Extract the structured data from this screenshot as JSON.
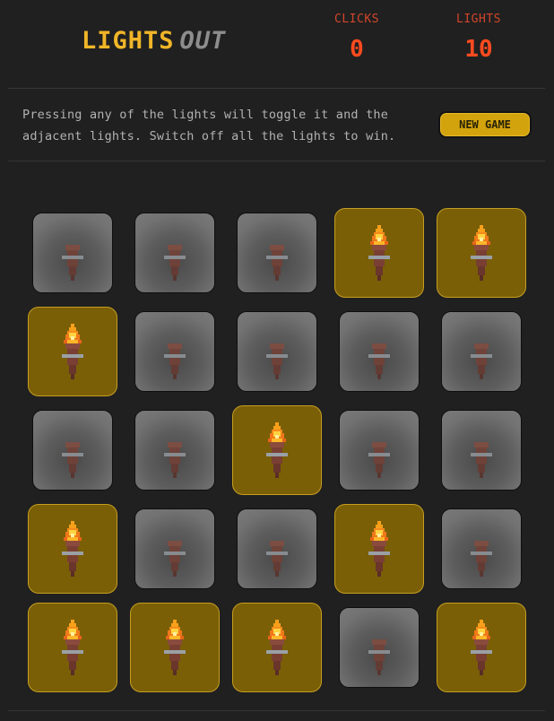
{
  "header": {
    "title_word1": "LIGHTS",
    "title_word2": "OUT",
    "clicks_label": "CLICKS",
    "clicks_value": "0",
    "lights_label": "LIGHTS",
    "lights_value": "10"
  },
  "instructions": {
    "line1": "Pressing any of the lights will toggle it and the",
    "line2": "adjacent lights. Switch off all the lights to win."
  },
  "controls": {
    "new_game_label": "NEW GAME"
  },
  "board": {
    "rows": 5,
    "cols": 5,
    "cells": [
      [
        false,
        false,
        false,
        true,
        true
      ],
      [
        true,
        false,
        false,
        false,
        false
      ],
      [
        false,
        false,
        true,
        false,
        false
      ],
      [
        true,
        false,
        false,
        true,
        false
      ],
      [
        true,
        true,
        true,
        false,
        true
      ]
    ],
    "icon": "torch-icon"
  },
  "colors": {
    "background": "#202020",
    "title_on": "#f0b528",
    "title_off": "#8d8d8d",
    "counter": "#ff4b1f",
    "button": "#d3a30d",
    "tile_on": "#7a5f07",
    "tile_off": "#6a6a6a"
  }
}
